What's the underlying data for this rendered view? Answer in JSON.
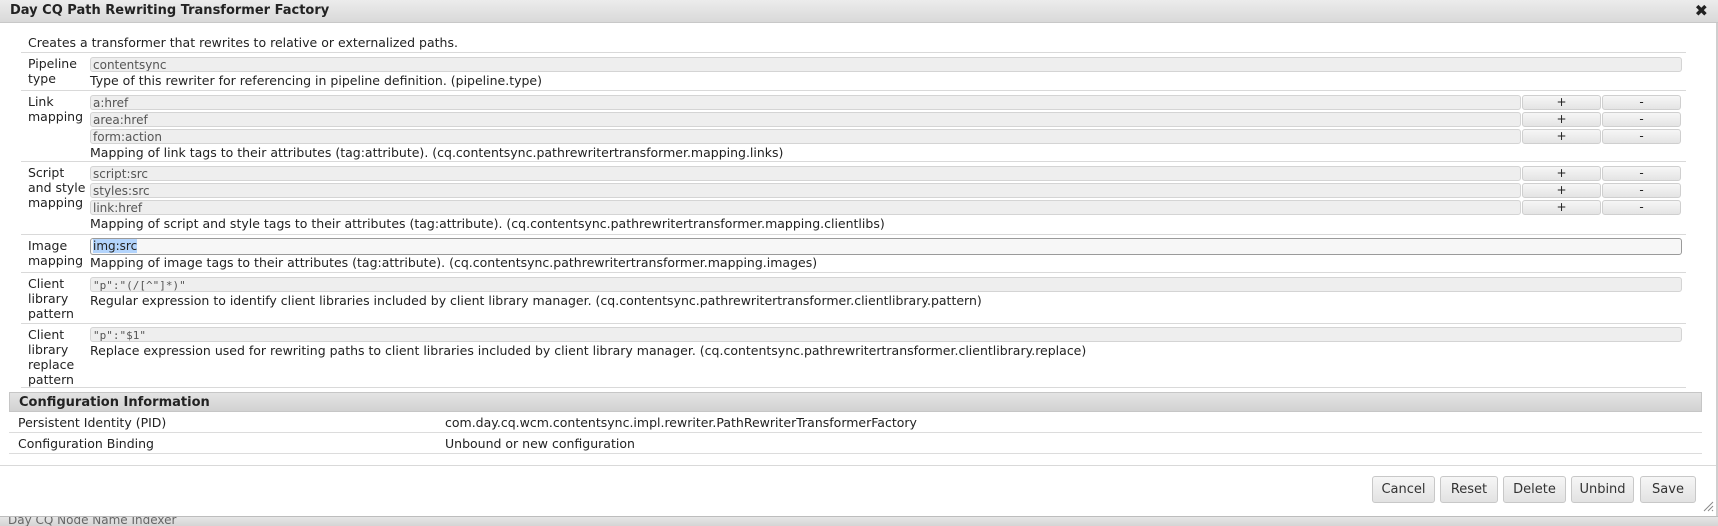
{
  "dialog": {
    "title": "Day CQ Path Rewriting Transformer Factory",
    "close_symbol": "✖",
    "description": "Creates a transformer that rewrites to relative or externalized paths."
  },
  "properties": {
    "pipeline_type": {
      "label": "Pipeline type",
      "value": "contentsync",
      "help": "Type of this rewriter for referencing in pipeline definition. (pipeline.type)"
    },
    "link_mapping": {
      "label": "Link mapping",
      "values": [
        "a:href",
        "area:href",
        "form:action"
      ],
      "help": "Mapping of link tags to their attributes (tag:attribute). (cq.contentsync.pathrewritertransformer.mapping.links)"
    },
    "script_style_mapping": {
      "label": "Script and style mapping",
      "values": [
        "script:src",
        "styles:src",
        "link:href"
      ],
      "help": "Mapping of script and style tags to their attributes (tag:attribute). (cq.contentsync.pathrewritertransformer.mapping.clientlibs)"
    },
    "image_mapping": {
      "label": "Image mapping",
      "value": "img:src",
      "help": "Mapping of image tags to their attributes (tag:attribute). (cq.contentsync.pathrewritertransformer.mapping.images)"
    },
    "client_library_pattern": {
      "label": "Client library pattern",
      "value": "\"p\":\"(/[^\"]*)\"",
      "help": "Regular expression to identify client libraries included by client library manager. (cq.contentsync.pathrewritertransformer.clientlibrary.pattern)"
    },
    "client_library_replace": {
      "label": "Client library replace pattern",
      "value": "\"p\":\"$1\"",
      "help": "Replace expression used for rewriting paths to client libraries included by client library manager. (cq.contentsync.pathrewritertransformer.clientlibrary.replace)"
    }
  },
  "row_buttons": {
    "add": "+",
    "remove": "-"
  },
  "config_info": {
    "heading": "Configuration Information",
    "rows": [
      {
        "key": "Persistent Identity (PID)",
        "value": "com.day.cq.wcm.contentsync.impl.rewriter.PathRewriterTransformerFactory"
      },
      {
        "key": "Configuration Binding",
        "value": "Unbound or new configuration"
      }
    ]
  },
  "actions": {
    "cancel": "Cancel",
    "reset": "Reset",
    "delete": "Delete",
    "unbind": "Unbind",
    "save": "Save"
  },
  "background": {
    "next_item": "Day CQ Node Name Indexer"
  }
}
